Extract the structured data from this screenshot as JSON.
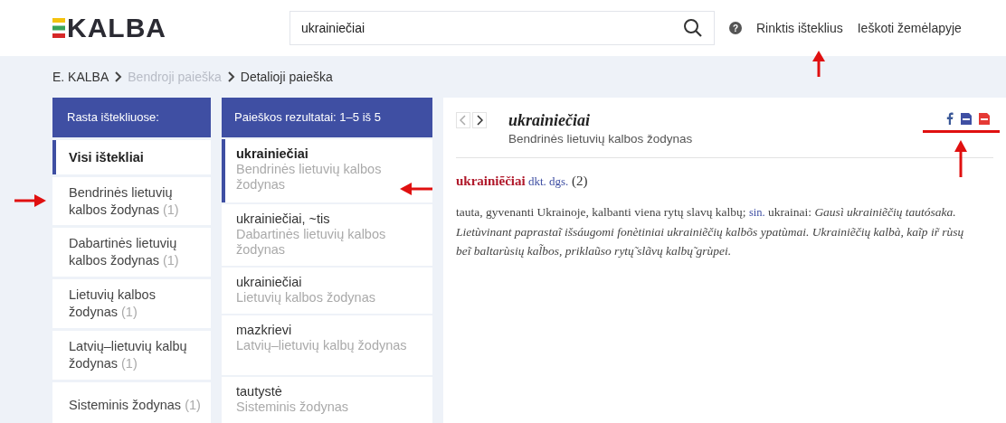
{
  "header": {
    "logo": "KALBA",
    "search": {
      "value": "ukrainiečiai"
    },
    "help": "?",
    "links": [
      "Rinktis išteklius",
      "Ieškoti žemėlapyje"
    ]
  },
  "breadcrumb": [
    {
      "label": "E. KALBA",
      "disabled": false
    },
    {
      "label": "Bendroji paieška",
      "disabled": true
    },
    {
      "label": "Detalioji paieška",
      "disabled": false
    }
  ],
  "sources": {
    "title": "Rasta ištekliuose:",
    "items": [
      {
        "label": "Visi ištekliai",
        "selected": true
      },
      {
        "label": "Bendrinės lietuvių kalbos žodynas",
        "count": "(1)",
        "selected": false
      },
      {
        "label": "Dabartinės lietuvių kalbos žodynas",
        "count": "(1)",
        "selected": false
      },
      {
        "label": "Lietuvių kalbos žodynas",
        "count": "(1)",
        "selected": false
      },
      {
        "label": "Latvių–lietuvių kalbų žodynas",
        "count": "(1)",
        "selected": false
      },
      {
        "label": "Sisteminis žodynas",
        "count": "(1)",
        "selected": false
      }
    ]
  },
  "results": {
    "title": "Paieškos rezultatai: 1–5 iš 5",
    "items": [
      {
        "word": "ukrainiečiai",
        "source": "Bendrinės lietuvių kalbos žodynas",
        "selected": true
      },
      {
        "word": "ukrainiečiai, ~tis",
        "source": "Dabartinės lietuvių kalbos žodynas",
        "selected": false
      },
      {
        "word": "ukrainiečiai",
        "source": "Lietuvių kalbos žodynas",
        "selected": false
      },
      {
        "word": "mazkrievi",
        "source": "Latvių–lietuvių kalbų žodynas",
        "selected": false
      },
      {
        "word": "tautystė",
        "source": "Sisteminis žodynas",
        "selected": false
      }
    ]
  },
  "entry": {
    "title": "ukrainiečiai",
    "source": "Bendrinės lietuvių kalbos žodynas",
    "headword": "ukrainiẽčiai",
    "grammar": "dkt. dgs.",
    "accent": "(2)",
    "definition": [
      {
        "kind": "text",
        "text": "tauta, gyvenanti Ukrainoje, kalbanti viena rytų slavų kalbų; "
      },
      {
        "kind": "label",
        "text": "sin."
      },
      {
        "kind": "text",
        "text": " ukrainai: "
      },
      {
        "kind": "example",
        "text": "Gausì ukrainiẽčių tautósaka. Lietùvinant paprastaĩ išsáugomi fonètiniai ukrainiẽčių kalbõs ypatùmai. Ukrainiẽčių kalbà, kaĩp ir̃ rùsų beĩ baltarùsių kal̃bos, priklaũso rytų̃ slãvų kalbų̃ grùpei."
      }
    ]
  }
}
